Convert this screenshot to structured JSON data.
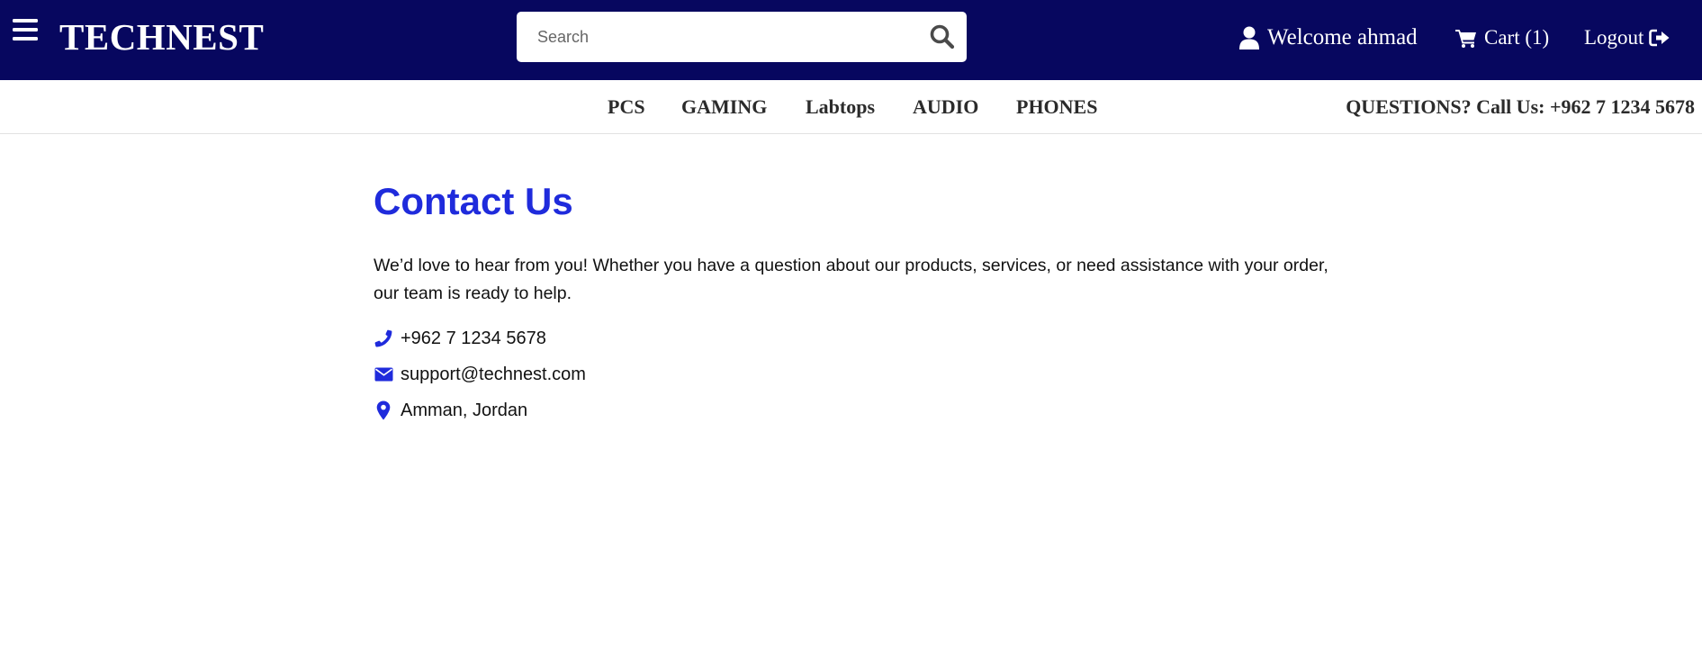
{
  "header": {
    "brand": "TECHNEST",
    "search": {
      "placeholder": "Search",
      "value": ""
    },
    "user_label": "Welcome ahmad",
    "cart_label": "Cart (1)",
    "logout_label": "Logout"
  },
  "categories": [
    {
      "label": "PCS"
    },
    {
      "label": "GAMING"
    },
    {
      "label": "Labtops"
    },
    {
      "label": "AUDIO"
    },
    {
      "label": "PHONES"
    }
  ],
  "callus_text": "QUESTIONS? Call Us: +962 7 1234 5678",
  "main": {
    "title": "Contact Us",
    "intro": "We’d love to hear from you! Whether you have a question about our products, services, or need assistance with your order, our team is ready to help.",
    "contacts": [
      {
        "icon": "phone-icon",
        "text": "+962 7 1234 5678"
      },
      {
        "icon": "envelope-icon",
        "text": "support@technest.com"
      },
      {
        "icon": "map-pin-icon",
        "text": "Amman, Jordan"
      }
    ]
  },
  "colors": {
    "header_bg": "#07075f",
    "accent": "#1f2bdc",
    "category_text": "#2b2b2b",
    "body_text": "#111111"
  }
}
